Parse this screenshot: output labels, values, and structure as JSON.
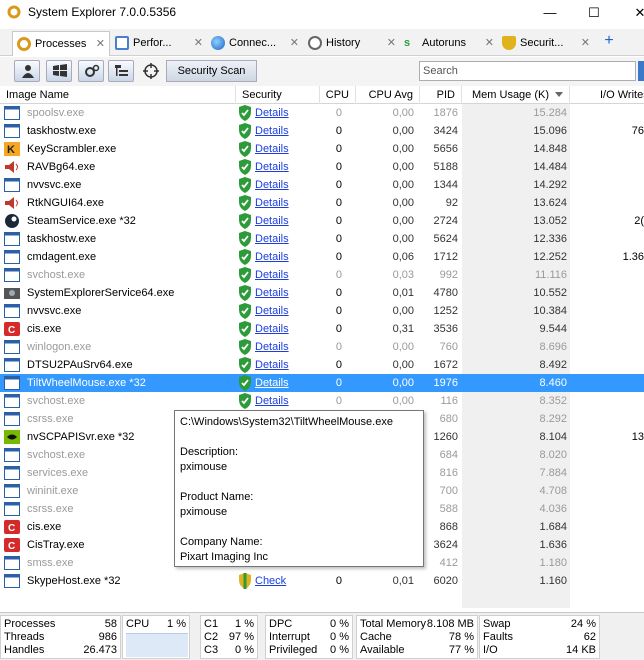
{
  "window": {
    "title": "System Explorer 7.0.0.5356",
    "min": "—",
    "max": "☐",
    "close": "✕"
  },
  "tabs": [
    {
      "label": "Processes",
      "icon": "gear-icon",
      "color": "#d99a1c",
      "close": "✕"
    },
    {
      "label": "Perfor...",
      "icon": "performance-icon",
      "color": "#4a7fd0",
      "close": "✕"
    },
    {
      "label": "Connec...",
      "icon": "globe-icon",
      "color": "#2f7fd6",
      "close": "✕"
    },
    {
      "label": "History",
      "icon": "clock-icon",
      "color": "#666666",
      "close": "✕"
    },
    {
      "label": "Autoruns",
      "icon": "autoruns-icon",
      "color": "#2e9b3b",
      "close": "✕"
    },
    {
      "label": "Securit...",
      "icon": "shield-icon",
      "color": "#e0b21c",
      "close": "✕"
    }
  ],
  "tab_add": "+",
  "toolbar": {
    "scan_label": "Security Scan",
    "search_placeholder": "Search"
  },
  "columns": {
    "name": "Image Name",
    "security": "Security",
    "cpu": "CPU",
    "cpu_avg": "CPU Avg",
    "pid": "PID",
    "mem": "Mem Usage (K)",
    "io": "I/O Writes"
  },
  "rows": [
    {
      "name": "spoolsv.exe",
      "security": "Details",
      "cpu": "0",
      "cpu_avg": "0,00",
      "pid": "1876",
      "mem": "15.284",
      "io": "",
      "gray": true,
      "icon": "window-icon"
    },
    {
      "name": "taskhostw.exe",
      "security": "Details",
      "cpu": "0",
      "cpu_avg": "0,00",
      "pid": "3424",
      "mem": "15.096",
      "io": "76",
      "gray": false,
      "icon": "window-icon"
    },
    {
      "name": "KeyScrambler.exe",
      "security": "Details",
      "cpu": "0",
      "cpu_avg": "0,00",
      "pid": "5656",
      "mem": "14.848",
      "io": "",
      "gray": false,
      "icon": "keyscrambler-icon"
    },
    {
      "name": "RAVBg64.exe",
      "security": "Details",
      "cpu": "0",
      "cpu_avg": "0,00",
      "pid": "5188",
      "mem": "14.484",
      "io": "",
      "gray": false,
      "icon": "speaker-icon"
    },
    {
      "name": "nvvsvc.exe",
      "security": "Details",
      "cpu": "0",
      "cpu_avg": "0,00",
      "pid": "1344",
      "mem": "14.292",
      "io": "",
      "gray": false,
      "icon": "window-icon"
    },
    {
      "name": "RtkNGUI64.exe",
      "security": "Details",
      "cpu": "0",
      "cpu_avg": "0,00",
      "pid": "92",
      "mem": "13.624",
      "io": "",
      "gray": false,
      "icon": "speaker-icon"
    },
    {
      "name": "SteamService.exe *32",
      "security": "Details",
      "cpu": "0",
      "cpu_avg": "0,00",
      "pid": "2724",
      "mem": "13.052",
      "io": "2(",
      "gray": false,
      "icon": "steam-icon"
    },
    {
      "name": "taskhostw.exe",
      "security": "Details",
      "cpu": "0",
      "cpu_avg": "0,00",
      "pid": "5624",
      "mem": "12.336",
      "io": "",
      "gray": false,
      "icon": "window-icon"
    },
    {
      "name": "cmdagent.exe",
      "security": "Details",
      "cpu": "0",
      "cpu_avg": "0,06",
      "pid": "1712",
      "mem": "12.252",
      "io": "1.36",
      "gray": false,
      "icon": "window-icon"
    },
    {
      "name": "svchost.exe",
      "security": "Details",
      "cpu": "0",
      "cpu_avg": "0,03",
      "pid": "992",
      "mem": "11.116",
      "io": "",
      "gray": true,
      "icon": "window-icon"
    },
    {
      "name": "SystemExplorerService64.exe",
      "security": "Details",
      "cpu": "0",
      "cpu_avg": "0,01",
      "pid": "4780",
      "mem": "10.552",
      "io": "",
      "gray": false,
      "icon": "sysexplorer-icon"
    },
    {
      "name": "nvvsvc.exe",
      "security": "Details",
      "cpu": "0",
      "cpu_avg": "0,00",
      "pid": "1252",
      "mem": "10.384",
      "io": "",
      "gray": false,
      "icon": "window-icon"
    },
    {
      "name": "cis.exe",
      "security": "Details",
      "cpu": "0",
      "cpu_avg": "0,31",
      "pid": "3536",
      "mem": "9.544",
      "io": "",
      "gray": false,
      "icon": "comodo-icon"
    },
    {
      "name": "winlogon.exe",
      "security": "Details",
      "cpu": "0",
      "cpu_avg": "0,00",
      "pid": "760",
      "mem": "8.696",
      "io": "",
      "gray": true,
      "icon": "window-icon"
    },
    {
      "name": "DTSU2PAuSrv64.exe",
      "security": "Details",
      "cpu": "0",
      "cpu_avg": "0,00",
      "pid": "1672",
      "mem": "8.492",
      "io": "",
      "gray": false,
      "icon": "window-icon"
    },
    {
      "name": "TiltWheelMouse.exe *32",
      "security": "Details",
      "cpu": "0",
      "cpu_avg": "0,00",
      "pid": "1976",
      "mem": "8.460",
      "io": "",
      "gray": false,
      "selected": true,
      "icon": "window-icon"
    },
    {
      "name": "svchost.exe",
      "security": "Details",
      "cpu": "0",
      "cpu_avg": "0,00",
      "pid": "116",
      "mem": "8.352",
      "io": "",
      "gray": true,
      "icon": "window-icon"
    },
    {
      "name": "csrss.exe",
      "security": "",
      "cpu": "",
      "cpu_avg": "",
      "pid": "680",
      "mem": "8.292",
      "io": "",
      "gray": true,
      "icon": "window-icon"
    },
    {
      "name": "nvSCPAPISvr.exe *32",
      "security": "",
      "cpu": "",
      "cpu_avg": "",
      "pid": "1260",
      "mem": "8.104",
      "io": "13",
      "gray": false,
      "icon": "nvidia-icon"
    },
    {
      "name": "svchost.exe",
      "security": "",
      "cpu": "",
      "cpu_avg": "",
      "pid": "684",
      "mem": "8.020",
      "io": "",
      "gray": true,
      "icon": "window-icon"
    },
    {
      "name": "services.exe",
      "security": "",
      "cpu": "",
      "cpu_avg": "",
      "pid": "816",
      "mem": "7.884",
      "io": "",
      "gray": true,
      "icon": "window-icon"
    },
    {
      "name": "wininit.exe",
      "security": "",
      "cpu": "",
      "cpu_avg": "",
      "pid": "700",
      "mem": "4.708",
      "io": "",
      "gray": true,
      "icon": "window-icon"
    },
    {
      "name": "csrss.exe",
      "security": "",
      "cpu": "",
      "cpu_avg": "",
      "pid": "588",
      "mem": "4.036",
      "io": "",
      "gray": true,
      "icon": "window-icon"
    },
    {
      "name": "cis.exe",
      "security": "",
      "cpu": "",
      "cpu_avg": "",
      "pid": "868",
      "mem": "1.684",
      "io": "",
      "gray": false,
      "icon": "comodo-icon"
    },
    {
      "name": "CisTray.exe",
      "security": "",
      "cpu": "",
      "cpu_avg": "",
      "pid": "3624",
      "mem": "1.636",
      "io": "",
      "gray": false,
      "icon": "comodo-icon"
    },
    {
      "name": "smss.exe",
      "security": "",
      "cpu": "",
      "cpu_avg": "",
      "pid": "412",
      "mem": "1.180",
      "io": "",
      "gray": true,
      "icon": "window-icon"
    },
    {
      "name": "SkypeHost.exe *32",
      "security": "Check",
      "cpu": "0",
      "cpu_avg": "0,01",
      "pid": "6020",
      "mem": "1.160",
      "io": "",
      "gray": false,
      "shield": "warning",
      "icon": "window-icon"
    }
  ],
  "tooltip": {
    "path": "C:\\Windows\\System32\\TiltWheelMouse.exe",
    "desc_label": "Description:",
    "desc": "pximouse",
    "product_label": "Product Name:",
    "product": "pximouse",
    "company_label": "Company Name:",
    "company": "Pixart Imaging Inc"
  },
  "status": {
    "processes_label": "Processes",
    "processes": "58",
    "threads_label": "Threads",
    "threads": "986",
    "handles_label": "Handles",
    "handles": "26.473",
    "cpu_label": "CPU",
    "cpu": "1 %",
    "c1_label": "C1",
    "c1": "1 %",
    "c2_label": "C2",
    "c2": "97 %",
    "c3_label": "C3",
    "c3": "0 %",
    "dpc_label": "DPC",
    "dpc": "0 %",
    "interrupt_label": "Interrupt",
    "interrupt": "0 %",
    "privileged_label": "Privileged",
    "privileged": "0 %",
    "total_mem_label": "Total Memory",
    "total_mem": "8.108 MB",
    "cache_label": "Cache",
    "cache": "78 %",
    "available_label": "Available",
    "available": "77 %",
    "swap_label": "Swap",
    "swap": "24 %",
    "faults_label": "Faults",
    "faults": "62",
    "io_label": "I/O",
    "io": "14 KB"
  },
  "colors": {
    "selection": "#3399ff",
    "link": "#1a3ee0",
    "shield_green": "#2e9b3b"
  }
}
